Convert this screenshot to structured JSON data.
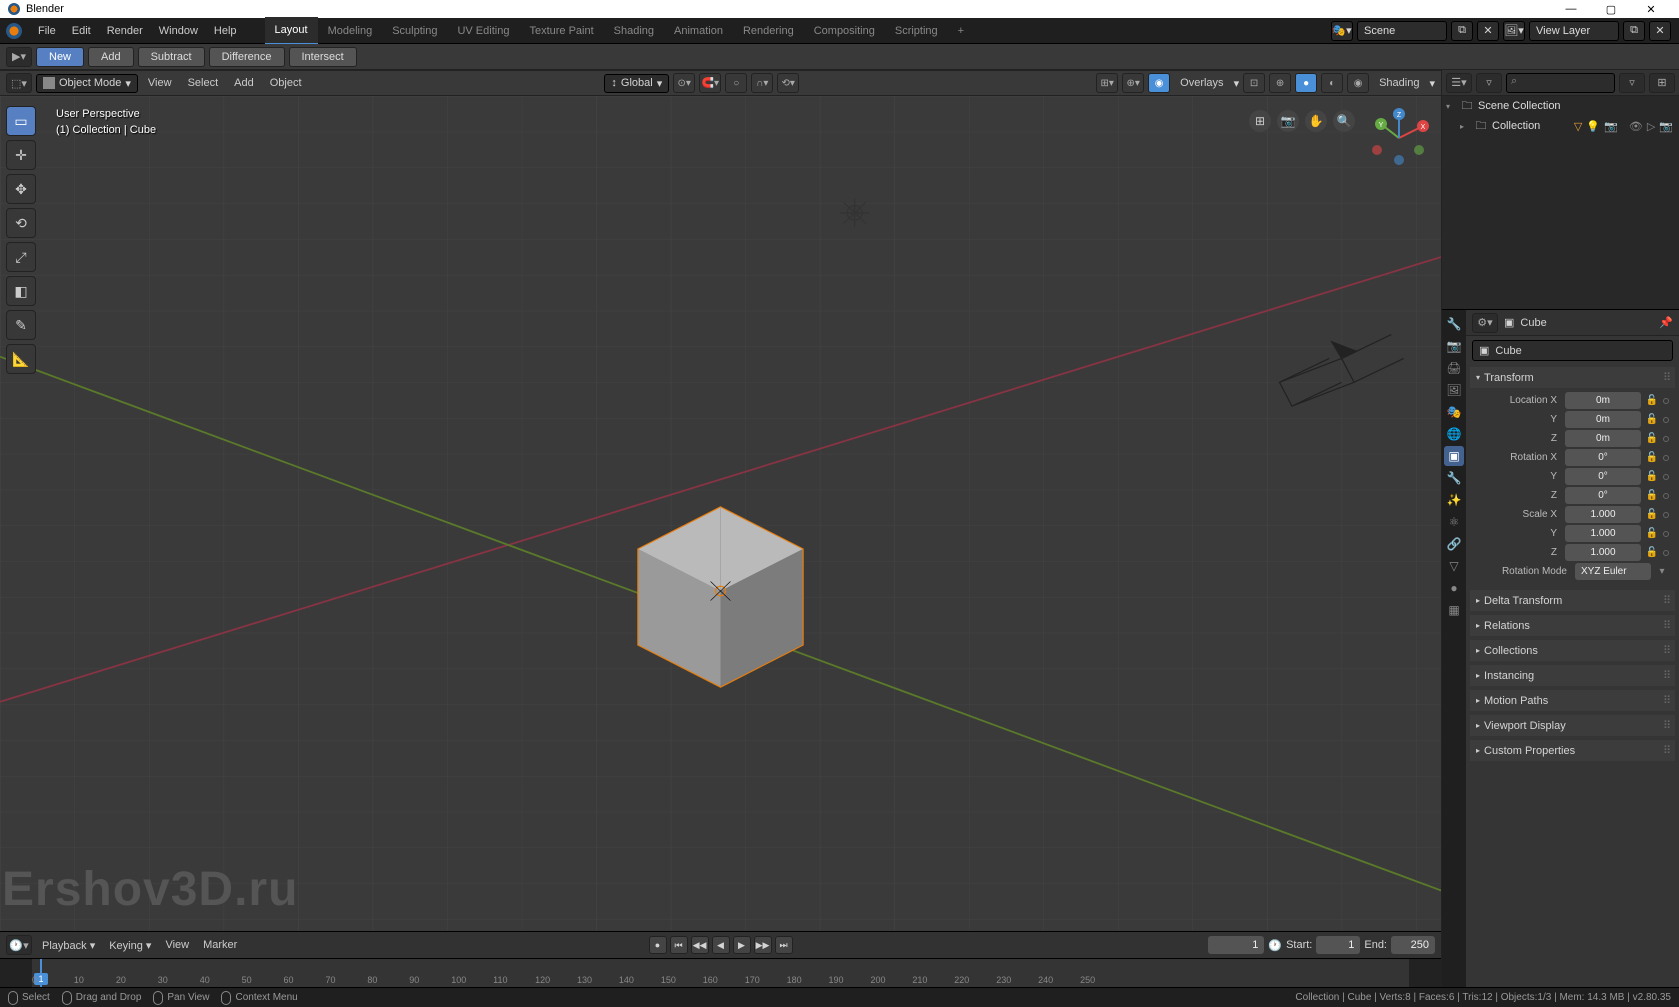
{
  "title": "Blender",
  "menus": [
    "File",
    "Edit",
    "Render",
    "Window",
    "Help"
  ],
  "workspaces": [
    "Layout",
    "Modeling",
    "Sculpting",
    "UV Editing",
    "Texture Paint",
    "Shading",
    "Animation",
    "Rendering",
    "Compositing",
    "Scripting"
  ],
  "active_workspace": "Layout",
  "scene_name": "Scene",
  "viewlayer_name": "View Layer",
  "tool_buttons": {
    "new": "New",
    "add": "Add",
    "subtract": "Subtract",
    "difference": "Difference",
    "intersect": "Intersect"
  },
  "viewport_header": {
    "mode": "Object Mode",
    "menus": [
      "View",
      "Select",
      "Add",
      "Object"
    ],
    "orientation": "Global",
    "overlays": "Overlays",
    "shading": "Shading"
  },
  "viewport_info": {
    "line1": "User Perspective",
    "line2": "(1) Collection | Cube"
  },
  "outliner": {
    "scene": "Scene Collection",
    "collection": "Collection"
  },
  "properties": {
    "object_name": "Cube",
    "datablock": "Cube",
    "transform_label": "Transform",
    "loc": {
      "label": "Location X",
      "y": "Y",
      "z": "Z",
      "vx": "0m",
      "vy": "0m",
      "vz": "0m"
    },
    "rot": {
      "label": "Rotation X",
      "y": "Y",
      "z": "Z",
      "vx": "0°",
      "vy": "0°",
      "vz": "0°"
    },
    "scl": {
      "label": "Scale X",
      "y": "Y",
      "z": "Z",
      "vx": "1.000",
      "vy": "1.000",
      "vz": "1.000"
    },
    "rotmode": {
      "label": "Rotation Mode",
      "val": "XYZ Euler"
    },
    "panels": [
      "Delta Transform",
      "Relations",
      "Collections",
      "Instancing",
      "Motion Paths",
      "Viewport Display",
      "Custom Properties"
    ]
  },
  "timeline": {
    "menus": [
      "Playback",
      "Keying",
      "View",
      "Marker"
    ],
    "current": "1",
    "start_label": "Start:",
    "start": "1",
    "end_label": "End:",
    "end": "250",
    "ticks": [
      0,
      10,
      20,
      30,
      40,
      50,
      60,
      70,
      80,
      90,
      100,
      110,
      120,
      130,
      140,
      150,
      160,
      170,
      180,
      190,
      200,
      210,
      220,
      230,
      240,
      250
    ]
  },
  "statusbar": {
    "select": "Select",
    "drag": "Drag and Drop",
    "pan": "Pan View",
    "ctx": "Context Menu",
    "right": "Collection | Cube | Verts:8 | Faces:6 | Tris:12 | Objects:1/3 | Mem: 14.3 MB | v2.80.35"
  },
  "watermark": "Ershov3D.ru"
}
